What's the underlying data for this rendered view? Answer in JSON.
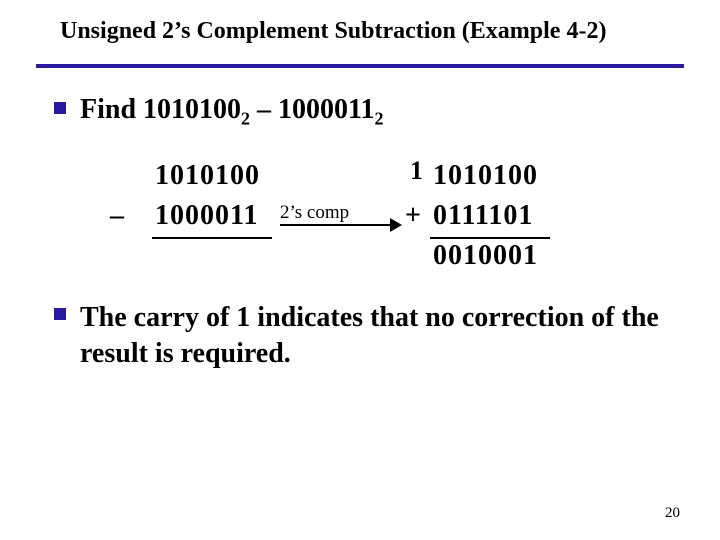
{
  "title": "Unsigned 2’s Complement Subtraction (Example 4-2)",
  "bullet1": {
    "prefix": "Find ",
    "minuend": "1010100",
    "minuend_base": "2",
    "sep": " – ",
    "subtrahend": "1000011",
    "subtrahend_base": "2"
  },
  "calc": {
    "left_top": "1010100",
    "left_sign": "–",
    "left_bot": "1000011",
    "arrow_label": "2’s comp",
    "carry": "1",
    "right_top": "1010100",
    "right_sign": "+",
    "right_bot": "0111101",
    "result": "0010001"
  },
  "bullet2": "The carry of 1 indicates that no correction of the result is required.",
  "page_number": "20"
}
